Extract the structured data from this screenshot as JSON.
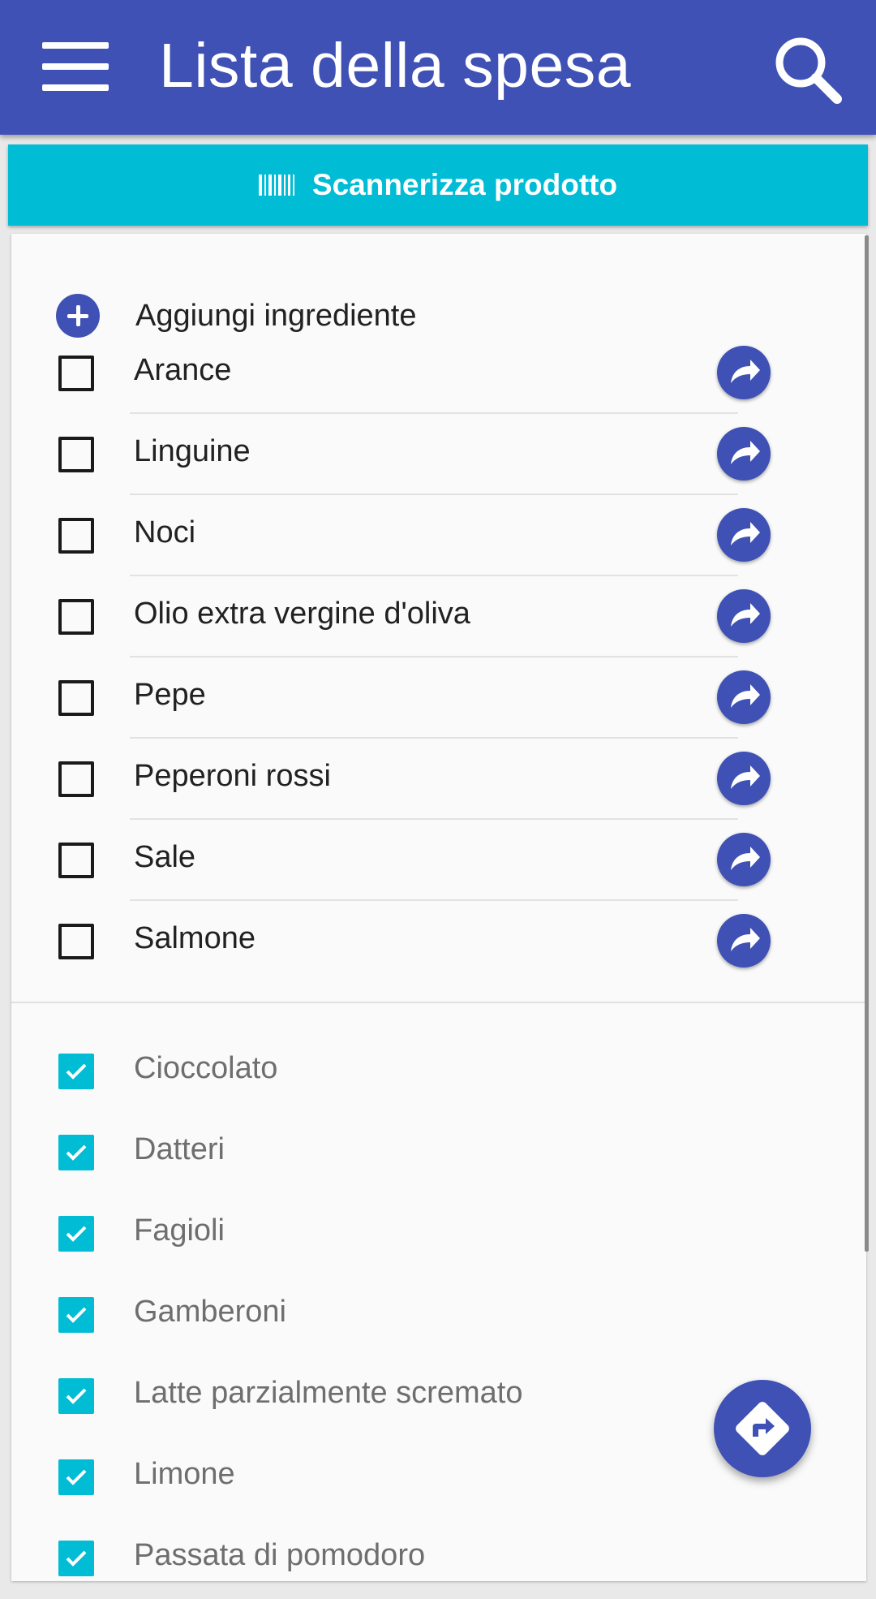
{
  "appbar": {
    "title": "Lista della spesa",
    "menu_icon": "hamburger-menu-icon",
    "search_icon": "search-icon",
    "color": "#3f51b5"
  },
  "scan_button": {
    "label": "Scannerizza prodotto",
    "icon": "barcode-icon",
    "color": "#00bcd4"
  },
  "add_ingredient": {
    "label": "Aggiungi ingrediente",
    "icon": "add-circle-icon"
  },
  "unchecked_items": [
    {
      "label": "Arance",
      "checked": false
    },
    {
      "label": "Linguine",
      "checked": false
    },
    {
      "label": "Noci",
      "checked": false
    },
    {
      "label": "Olio extra vergine d'oliva",
      "checked": false
    },
    {
      "label": "Pepe",
      "checked": false
    },
    {
      "label": "Peperoni rossi",
      "checked": false
    },
    {
      "label": "Sale",
      "checked": false
    },
    {
      "label": "Salmone",
      "checked": false
    }
  ],
  "checked_items": [
    {
      "label": "Cioccolato",
      "checked": true
    },
    {
      "label": "Datteri",
      "checked": true
    },
    {
      "label": "Fagioli",
      "checked": true
    },
    {
      "label": "Gamberoni",
      "checked": true
    },
    {
      "label": "Latte parzialmente scremato",
      "checked": true
    },
    {
      "label": "Limone",
      "checked": true
    },
    {
      "label": "Passata di pomodoro",
      "checked": true
    }
  ],
  "row_action_icon": "forward-arrow-icon",
  "fab_icon": "directions-icon",
  "colors": {
    "primary": "#3f51b5",
    "accent": "#00bcd4",
    "checked_text": "#6e6e6e"
  }
}
